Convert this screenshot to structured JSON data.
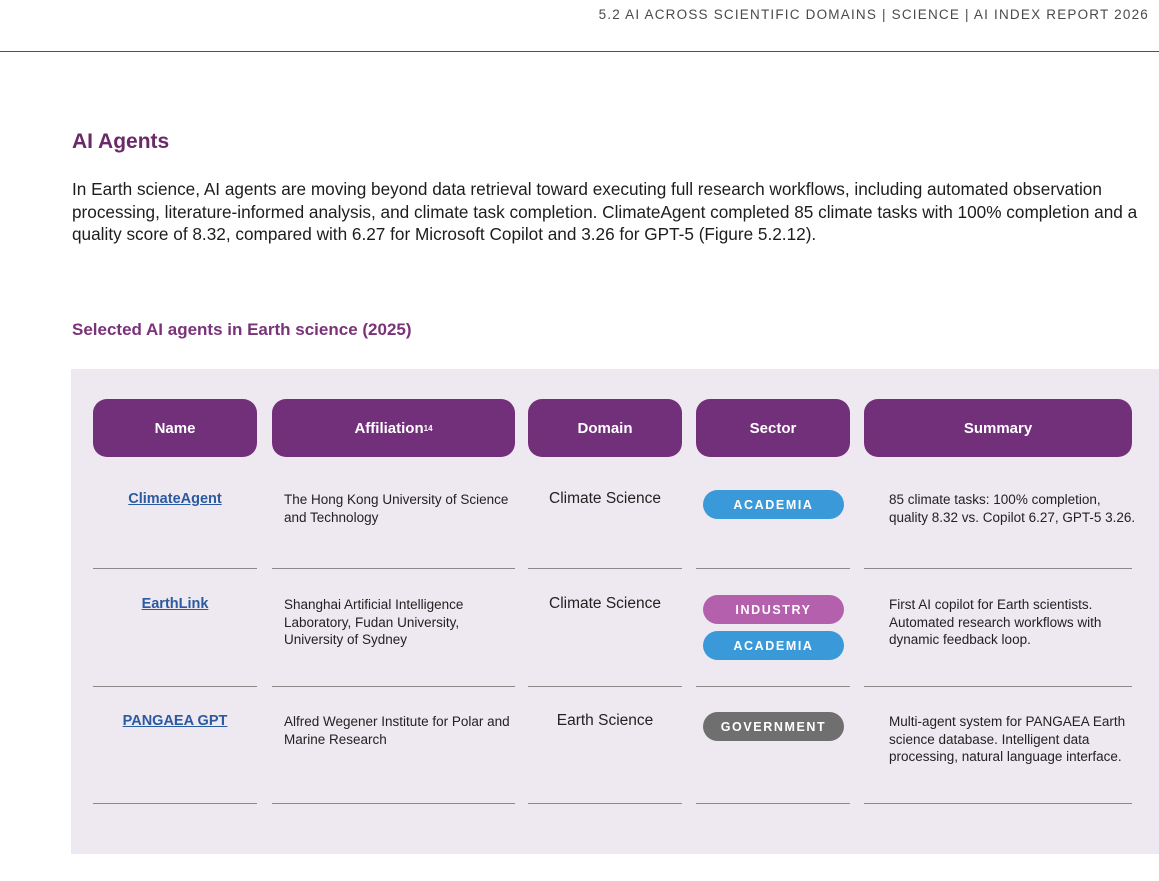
{
  "header": {
    "running_title": "5.2 AI ACROSS SCIENTIFIC DOMAINS  |  SCIENCE  |  AI INDEX REPORT 2026"
  },
  "section": {
    "heading": "AI Agents",
    "intro": "In Earth science, AI agents are moving beyond data retrieval toward executing full research workflows, including automated observation processing, literature-informed analysis, and climate task completion. ClimateAgent completed 85 climate tasks with 100% completion and a quality score of 8.32, compared with 6.27 for Microsoft Copilot and 3.26 for GPT-5 (Figure 5.2.12)."
  },
  "figure": {
    "title": "Selected AI agents in Earth science (2025)",
    "columns": [
      "Name",
      "Affiliation",
      "Domain",
      "Sector",
      "Summary"
    ],
    "affiliation_footnote": "14",
    "rows": [
      {
        "name": "ClimateAgent",
        "affiliation": "The Hong Kong University of Science and Technology",
        "domain": "Climate Science",
        "sectors": [
          "ACADEMIA"
        ],
        "summary": "85 climate tasks: 100% completion, quality 8.32 vs. Copilot 6.27, GPT-5 3.26."
      },
      {
        "name": "EarthLink",
        "affiliation": "Shanghai Artificial Intelligence Laboratory, Fudan University, University of Sydney",
        "domain": "Climate Science",
        "sectors": [
          "INDUSTRY",
          "ACADEMIA"
        ],
        "summary": "First AI copilot for Earth scientists. Automated research workflows with dynamic feedback loop."
      },
      {
        "name": "PANGAEA GPT",
        "affiliation": "Alfred Wegener Institute for Polar and Marine Research",
        "domain": "Earth Science",
        "sectors": [
          "GOVERNMENT"
        ],
        "summary": "Multi-agent system for PANGAEA Earth science database. Intelligent data processing, natural language interface."
      }
    ]
  },
  "colors": {
    "header_fill": "#73307a",
    "panel_bg": "#eee8f0",
    "link": "#2a5aa0",
    "academia": "#3a9ad9",
    "industry": "#b560ad",
    "government": "#6f6f6f"
  }
}
